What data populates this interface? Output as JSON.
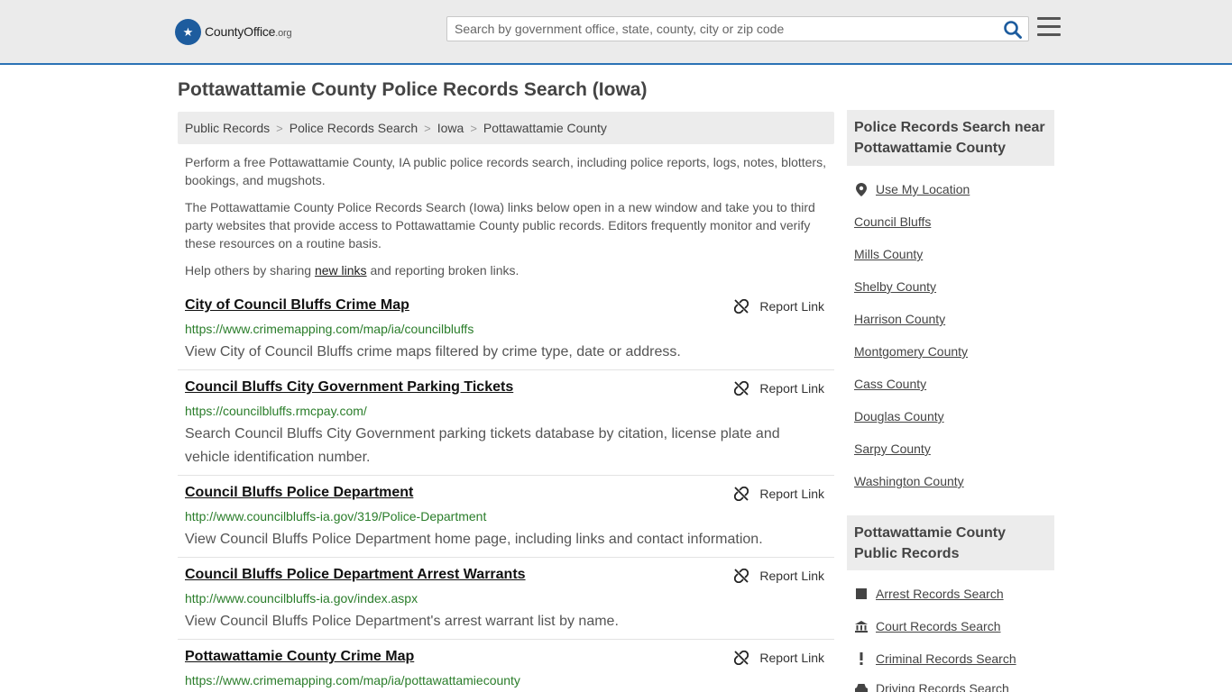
{
  "header": {
    "logo_text": "CountyOffice",
    "logo_suffix": ".org",
    "search_placeholder": "Search by government office, state, county, city or zip code"
  },
  "page_title": "Pottawattamie County Police Records Search (Iowa)",
  "breadcrumb": [
    "Public Records",
    "Police Records Search",
    "Iowa",
    "Pottawattamie County"
  ],
  "intro": {
    "p1": "Perform a free Pottawattamie County, IA public police records search, including police reports, logs, notes, blotters, bookings, and mugshots.",
    "p2": "The Pottawattamie County Police Records Search (Iowa) links below open in a new window and take you to third party websites that provide access to Pottawattamie County public records. Editors frequently monitor and verify these resources on a routine basis.",
    "p3_before": "Help others by sharing ",
    "p3_link": "new links",
    "p3_after": " and reporting broken links."
  },
  "report_label": "Report Link",
  "results": [
    {
      "title": "City of Council Bluffs Crime Map",
      "url": "https://www.crimemapping.com/map/ia/councilbluffs",
      "desc": "View City of Council Bluffs crime maps filtered by crime type, date or address."
    },
    {
      "title": "Council Bluffs City Government Parking Tickets",
      "url": "https://councilbluffs.rmcpay.com/",
      "desc": "Search Council Bluffs City Government parking tickets database by citation, license plate and vehicle identification number."
    },
    {
      "title": "Council Bluffs Police Department",
      "url": "http://www.councilbluffs-ia.gov/319/Police-Department",
      "desc": "View Council Bluffs Police Department home page, including links and contact information."
    },
    {
      "title": "Council Bluffs Police Department Arrest Warrants",
      "url": "http://www.councilbluffs-ia.gov/index.aspx",
      "desc": "View Council Bluffs Police Department's arrest warrant list by name."
    },
    {
      "title": "Pottawattamie County Crime Map",
      "url": "https://www.crimemapping.com/map/ia/pottawattamiecounty",
      "desc": ""
    }
  ],
  "sidebar": {
    "near_heading": "Police Records Search near Pottawattamie County",
    "use_location": "Use My Location",
    "near_links": [
      "Council Bluffs",
      "Mills County",
      "Shelby County",
      "Harrison County",
      "Montgomery County",
      "Cass County",
      "Douglas County",
      "Sarpy County",
      "Washington County"
    ],
    "records_heading": "Pottawattamie County Public Records",
    "records_links": [
      {
        "label": "Arrest Records Search",
        "icon": "square-icon"
      },
      {
        "label": "Court Records Search",
        "icon": "courthouse-icon"
      },
      {
        "label": "Criminal Records Search",
        "icon": "exclamation-icon"
      },
      {
        "label": "Driving Records Search",
        "icon": "car-icon"
      }
    ]
  },
  "colors": {
    "accent": "#2a72b5",
    "url_green": "#2a7d2a",
    "logo_blue": "#1d5c9e"
  }
}
